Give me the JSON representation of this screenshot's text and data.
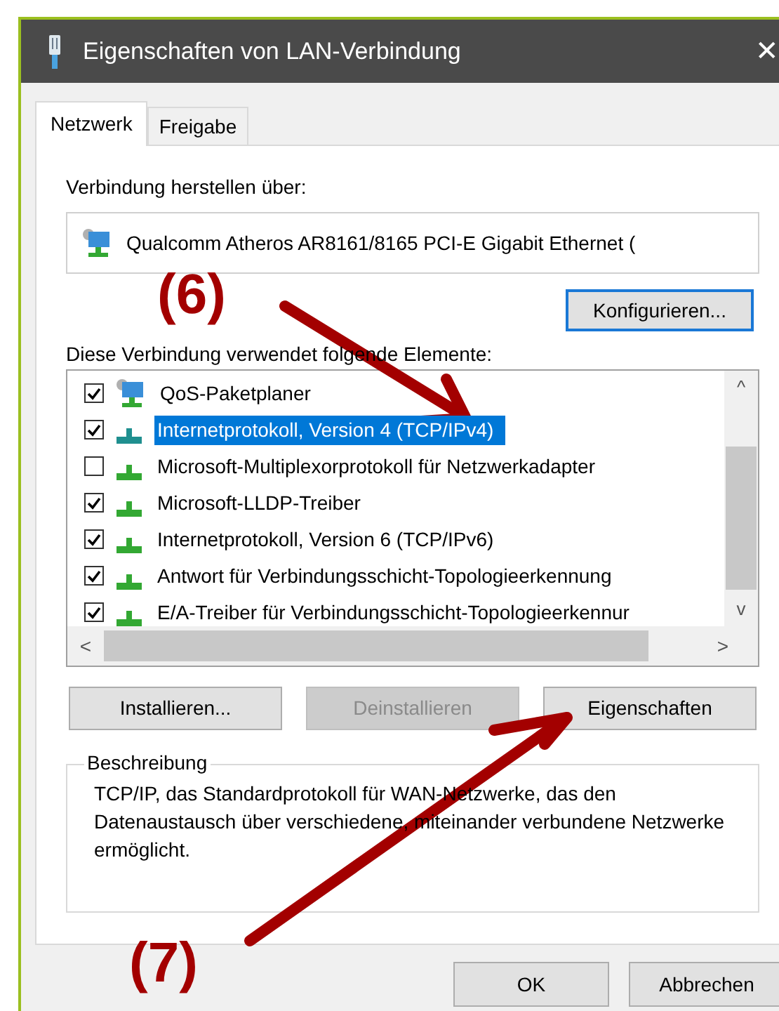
{
  "window": {
    "title": "Eigenschaften von LAN-Verbindung",
    "close": "✕"
  },
  "tabs": [
    {
      "label": "Netzwerk",
      "selected": true
    },
    {
      "label": "Freigabe",
      "selected": false
    }
  ],
  "connect_label": "Verbindung herstellen über:",
  "adapter": "Qualcomm Atheros AR8161/8165 PCI-E Gigabit Ethernet (",
  "configure_button": "Konfigurieren...",
  "items_label": "Diese Verbindung verwendet folgende Elemente:",
  "items": [
    {
      "label": "QoS-Paketplaner",
      "kind": "service",
      "checked": true,
      "selected": false
    },
    {
      "label": "Internetprotokoll, Version 4 (TCP/IPv4)",
      "kind": "protocol",
      "checked": true,
      "selected": true
    },
    {
      "label": "Microsoft-Multiplexorprotokoll für Netzwerkadapter",
      "kind": "protocol",
      "checked": false,
      "selected": false
    },
    {
      "label": "Microsoft-LLDP-Treiber",
      "kind": "protocol",
      "checked": true,
      "selected": false
    },
    {
      "label": "Internetprotokoll, Version 6 (TCP/IPv6)",
      "kind": "protocol",
      "checked": true,
      "selected": false
    },
    {
      "label": "Antwort für Verbindungsschicht-Topologieerkennung",
      "kind": "protocol",
      "checked": true,
      "selected": false
    },
    {
      "label": "E/A-Treiber für Verbindungsschicht-Topologieerkennur",
      "kind": "protocol",
      "checked": true,
      "selected": false
    }
  ],
  "scroll_arrows": {
    "up": "^",
    "down": "v",
    "left": "<",
    "right": ">"
  },
  "buttons": [
    {
      "label": "Installieren...",
      "disabled": false
    },
    {
      "label": "Deinstallieren",
      "disabled": true
    },
    {
      "label": "Eigenschaften",
      "disabled": false
    }
  ],
  "description": {
    "legend": "Beschreibung",
    "text": "TCP/IP, das Standardprotokoll für WAN-Netzwerke, das den Datenaustausch über verschiedene, miteinander verbundene Netzwerke ermöglicht."
  },
  "dialog_buttons": [
    "OK",
    "Abbrechen"
  ],
  "annotations": [
    "(6)",
    "(7)"
  ]
}
